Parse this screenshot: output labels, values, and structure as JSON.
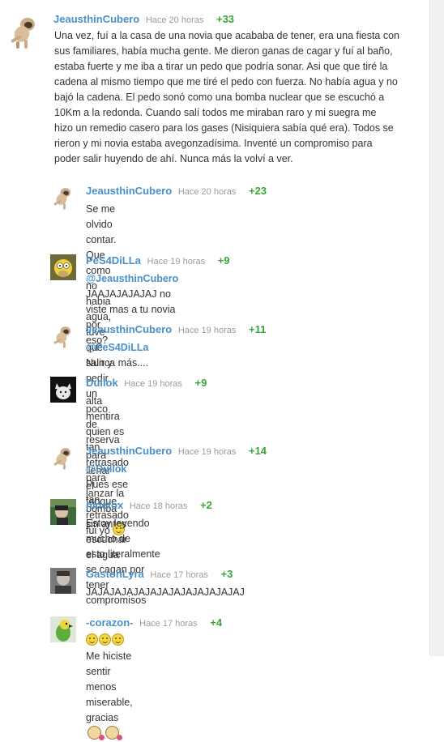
{
  "comments": [
    {
      "user": "JeausthinCubero",
      "time": "Hace 20 horas",
      "votes": "+33",
      "lines": [
        "Una vez, fuí a la casa de una novia que acababa de tener, era una fiesta con",
        "sus familiares, había mucha gente. Me dieron ganas de cagar y fuí al baño,",
        "estaba fuerte y me iba a tirar un pedo que podría sonar. Asi que que tiré la",
        "cadena al mismo tiempo que me tiré el pedo con fuerza. No había agua y no",
        "bajó la cadena. El pedo sonó como una bomba nuclear que se escuchó a",
        "10Km a la redonda. Cuando salí todos me miraban raro y mi suegra me",
        "hizo un remedio casero para los gases (Nisiquiera sabía qué era). Todos se",
        "rieron y mi novia estaba avegonzadísima. Inventé un compromiso para",
        "poder salir huyendo de ahí. Nunca más la volví a ver."
      ]
    }
  ],
  "replies": [
    {
      "user": "JeausthinCubero",
      "time": "Hace 20 horas",
      "votes": "+23",
      "lines": [
        "Se me olvido contar. Que como no habia agua, tuve que salir y pedir",
        "un poco de reserva para llenar el tanque."
      ]
    },
    {
      "user": "PeS4DiLLa",
      "time": "Hace 19 horas",
      "votes": "+9",
      "mention": "@JeausthinCubero",
      "line1_rest": " JAAJAJAJAJAJ no viste mas a tu novia por",
      "line2": "eso?"
    },
    {
      "user": "JeausthinCubero",
      "time": "Hace 19 horas",
      "votes": "+11",
      "mention": "@PeS4DiLLa",
      "line1_rest": " Nunca más...."
    },
    {
      "user": "Dullok",
      "time": "Hace 19 horas",
      "votes": "+9",
      "lines": [
        "alta mentira quien es tan retrasado para lanzar la bomba sin antes",
        "escuchar el agua"
      ]
    },
    {
      "user": "JeausthinCubero",
      "time": "Hace 19 horas",
      "votes": "+14",
      "mention": "@Dullok",
      "line1_rest": " Pues ese tan retrasado fui yo"
    },
    {
      "user": "hidetox",
      "time": "Hace 18 horas",
      "votes": "+2",
      "lines": [
        "Estoy leyendo mucho de esto,literalmente se cagan por tener",
        "compromisos"
      ]
    },
    {
      "user": "GastonLyra",
      "time": "Hace 17 horas",
      "votes": "+3",
      "lines": [
        "JAJAJAJAJAJAJAJAJAJAJAJAJAJ"
      ]
    },
    {
      "user": "-corazon-",
      "time": "Hace 17 horas",
      "votes": "+4",
      "text": " Me hiciste sentir menos miserable, gracias"
    }
  ],
  "colors": {
    "username": "#4a90c8",
    "votes": "#3aa53a",
    "time": "#9a9a9a",
    "text": "#333333"
  }
}
